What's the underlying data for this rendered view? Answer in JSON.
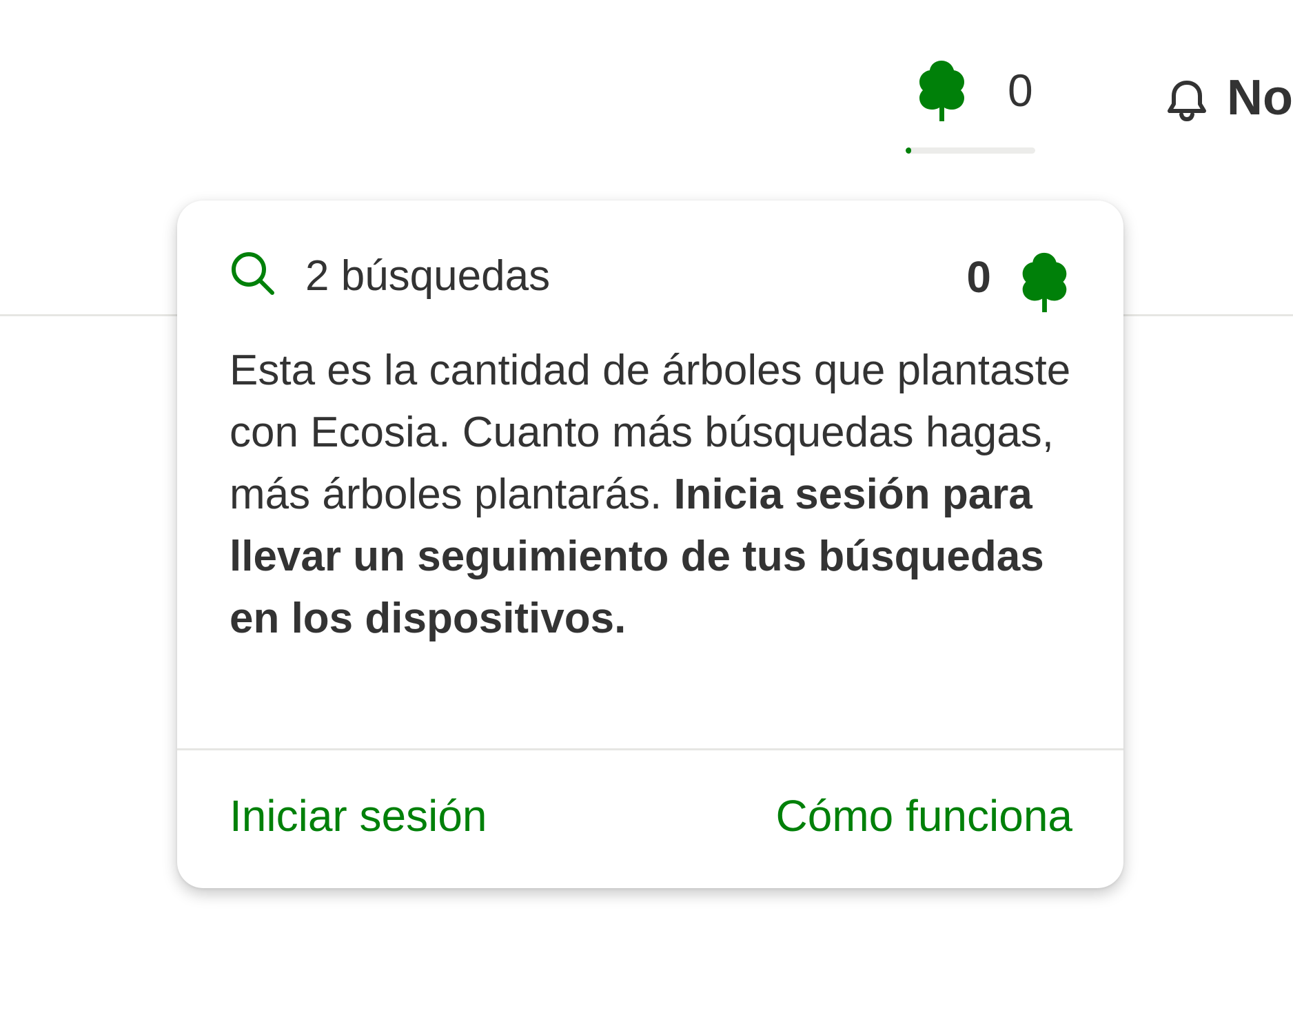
{
  "header": {
    "tree_counter": {
      "count": "0",
      "progress_fraction": 0.04,
      "icon": "tree-icon"
    },
    "notifications": {
      "label": "No",
      "icon": "bell-icon"
    }
  },
  "popup": {
    "search_count_label": "2 búsquedas",
    "search_icon": "search-icon",
    "tree_total": "0",
    "tree_icon": "tree-icon",
    "description_regular": "Esta es la cantidad de árboles que plantaste con Ecosia. Cuanto más búsquedas hagas, más árboles plantarás.",
    "description_bold": "Inicia sesión para llevar un seguimiento de tus búsquedas en los dispositivos.",
    "footer": {
      "login_label": "Iniciar sesión",
      "how_it_works_label": "Cómo funciona"
    }
  },
  "colors": {
    "brand_green": "#008009",
    "text": "#333333",
    "divider": "#e6e6e3"
  }
}
